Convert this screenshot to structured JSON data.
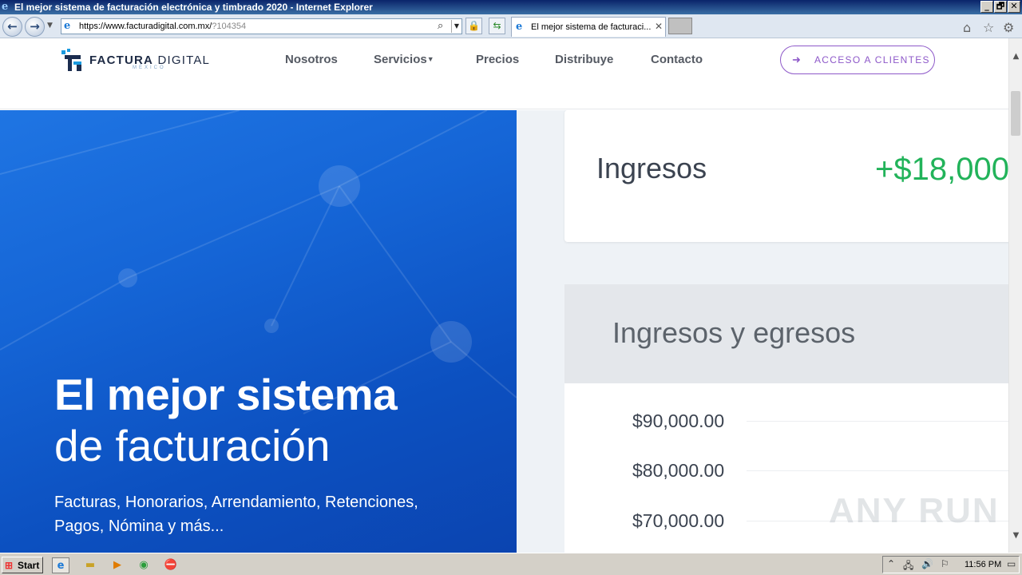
{
  "window": {
    "title": "El mejor sistema de facturación electrónica y timbrado 2020 - Internet Explorer",
    "controls": {
      "minimize": "_",
      "maximize": "🗗",
      "close": "✕"
    }
  },
  "browser": {
    "url_main": "https://www.facturadigital.com.mx/",
    "url_rest": "?104354",
    "tab_title": "El mejor sistema de facturaci...",
    "icons": [
      "back-icon",
      "forward-icon",
      "search-icon",
      "lock-icon",
      "refresh-icon",
      "home-icon",
      "favorites-star-icon",
      "gear-icon"
    ]
  },
  "site": {
    "logo": {
      "brand_bold": "FACTURA",
      "brand_regular": "DIGITAL",
      "sub": "MÉXICO"
    },
    "nav": [
      {
        "label": "Nosotros"
      },
      {
        "label": "Servicios"
      },
      {
        "label": "Precios"
      },
      {
        "label": "Distribuye"
      },
      {
        "label": "Contacto"
      }
    ],
    "cta": {
      "label": "ACCESO A CLIENTES",
      "icon": "sign-in-icon"
    },
    "hero": {
      "title_bold": "El mejor sistema",
      "title_regular": "de facturación",
      "subtitle": "Facturas, Honorarios, Arrendamiento, Retenciones, Pagos, Nómina y más..."
    },
    "dashboard": {
      "income_label": "Ingresos",
      "income_value": "+$18,000",
      "chart_title": "Ingresos y egresos",
      "y_ticks": [
        "$90,000.00",
        "$80,000.00",
        "$70,000.00"
      ]
    }
  },
  "watermark": "ANY RUN",
  "taskbar": {
    "start_label": "Start",
    "clock": "11:56 PM",
    "apps": [
      "internet-explorer-icon",
      "folder-icon",
      "media-player-icon",
      "chrome-icon",
      "stop-icon"
    ]
  },
  "colors": {
    "accent_purple": "#8e59c9",
    "income_green": "#22b35a",
    "hero_blue": "#1565d6"
  }
}
